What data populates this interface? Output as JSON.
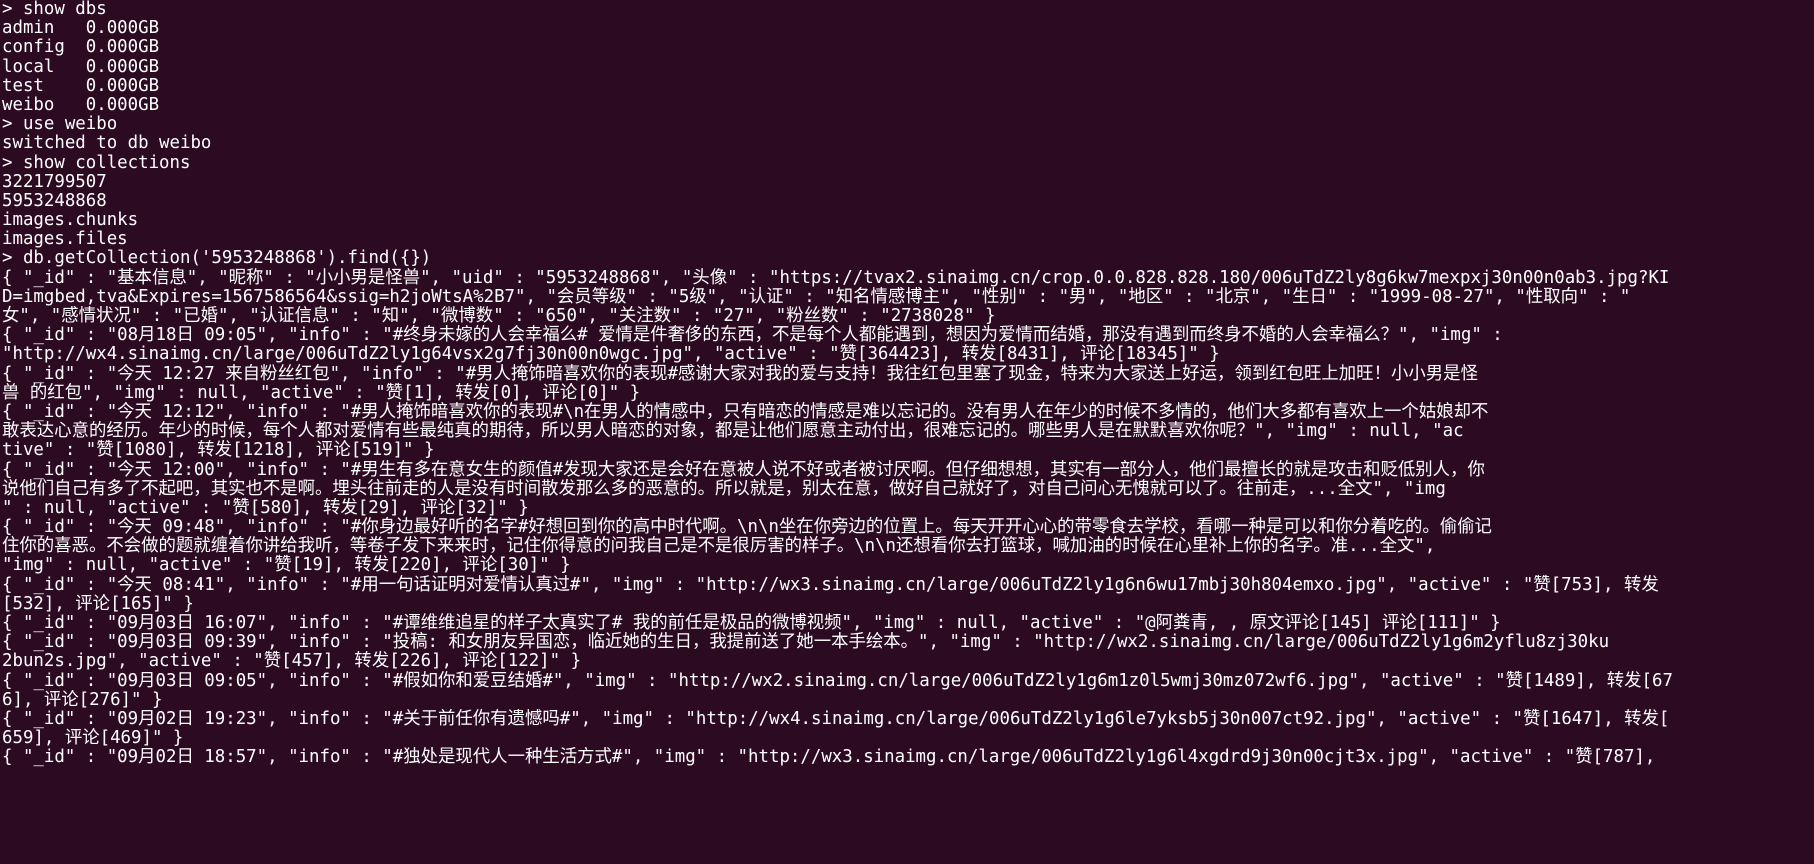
{
  "terminal": {
    "theme": {
      "background": "#2c0a22",
      "foreground": "#ffffff"
    },
    "lines": [
      "> show dbs",
      "admin   0.000GB",
      "config  0.000GB",
      "local   0.000GB",
      "test    0.000GB",
      "weibo   0.000GB",
      "> use weibo",
      "switched to db weibo",
      "> show collections",
      "3221799507",
      "5953248868",
      "images.chunks",
      "images.files",
      "> db.getCollection('5953248868').find({})",
      "{ \"_id\" : \"基本信息\", \"昵称\" : \"小小男是怪兽\", \"uid\" : \"5953248868\", \"头像\" : \"https://tvax2.sinaimg.cn/crop.0.0.828.828.180/006uTdZ2ly8g6kw7mexpxj30n00n0ab3.jpg?KI",
      "D=imgbed,tva&Expires=1567586564&ssig=h2joWtsA%2B7\", \"会员等级\" : \"5级\", \"认证\" : \"知名情感博主\", \"性别\" : \"男\", \"地区\" : \"北京\", \"生日\" : \"1999-08-27\", \"性取向\" : \"",
      "女\", \"感情状况\" : \"已婚\", \"认证信息\" : \"知\", \"微博数\" : \"650\", \"关注数\" : \"27\", \"粉丝数\" : \"2738028\" }",
      "{ \"_id\" : \"08月18日 09:05\", \"info\" : \"#终身未嫁的人会幸福么# 爱情是件奢侈的东西，不是每个人都能遇到，想因为爱情而结婚，那没有遇到而终身不婚的人会幸福么？\", \"img\" :",
      "\"http://wx4.sinaimg.cn/large/006uTdZ2ly1g64vsx2g7fj30n00n0wgc.jpg\", \"active\" : \"赞[364423], 转发[8431], 评论[18345]\" }",
      "{ \"_id\" : \"今天 12:27 来自粉丝红包\", \"info\" : \"#男人掩饰暗喜欢你的表现#感谢大家对我的爱与支持！我往红包里塞了现金，特来为大家送上好运，领到红包旺上加旺！小小男是怪",
      "兽 的红包\", \"img\" : null, \"active\" : \"赞[1], 转发[0], 评论[0]\" }",
      "{ \"_id\" : \"今天 12:12\", \"info\" : \"#男人掩饰暗喜欢你的表现#\\n在男人的情感中，只有暗恋的情感是难以忘记的。没有男人在年少的时候不多情的，他们大多都有喜欢上一个姑娘却不",
      "敢表达心意的经历。年少的时候，每个人都对爱情有些最纯真的期待，所以男人暗恋的对象，都是让他们愿意主动付出，很难忘记的。哪些男人是在默默喜欢你呢？\", \"img\" : null, \"ac",
      "tive\" : \"赞[1080], 转发[1218], 评论[519]\" }",
      "{ \"_id\" : \"今天 12:00\", \"info\" : \"#男生有多在意女生的颜值#发现大家还是会好在意被人说不好或者被讨厌啊。但仔细想想，其实有一部分人，他们最擅长的就是攻击和贬低别人，你",
      "说他们自己有多了不起吧，其实也不是啊。埋头往前走的人是没有时间散发那么多的恶意的。所以就是，别太在意，做好自己就好了，对自己问心无愧就可以了。往前走，...全文\", \"img",
      "\" : null, \"active\" : \"赞[580], 转发[29], 评论[32]\" }",
      "{ \"_id\" : \"今天 09:48\", \"info\" : \"#你身边最好听的名字#好想回到你的高中时代啊。\\n\\n坐在你旁边的位置上。每天开开心心的带零食去学校，看哪一种是可以和你分着吃的。偷偷记",
      "住你的喜恶。不会做的题就缠着你讲给我听，等卷子发下来来时，记住你得意的问我自己是不是很厉害的样子。\\n\\n还想看你去打篮球，喊加油的时候在心里补上你的名字。准...全文\",",
      "\"img\" : null, \"active\" : \"赞[19], 转发[220], 评论[30]\" }",
      "{ \"_id\" : \"今天 08:41\", \"info\" : \"#用一句话证明对爱情认真过#\", \"img\" : \"http://wx3.sinaimg.cn/large/006uTdZ2ly1g6n6wu17mbj30h804emxo.jpg\", \"active\" : \"赞[753], 转发",
      "[532], 评论[165]\" }",
      "{ \"_id\" : \"09月03日 16:07\", \"info\" : \"#谭维维追星的样子太真实了# 我的前任是极品的微博视频\", \"img\" : null, \"active\" : \"@阿粪青, , 原文评论[145] 评论[111]\" }",
      "{ \"_id\" : \"09月03日 09:39\", \"info\" : \"投稿: 和女朋友异国恋，临近她的生日，我提前送了她一本手绘本。\", \"img\" : \"http://wx2.sinaimg.cn/large/006uTdZ2ly1g6m2yflu8zj30ku",
      "2bun2s.jpg\", \"active\" : \"赞[457], 转发[226], 评论[122]\" }",
      "{ \"_id\" : \"09月03日 09:05\", \"info\" : \"#假如你和爱豆结婚#\", \"img\" : \"http://wx2.sinaimg.cn/large/006uTdZ2ly1g6m1z0l5wmj30mz072wf6.jpg\", \"active\" : \"赞[1489], 转发[67",
      "6], 评论[276]\" }",
      "{ \"_id\" : \"09月02日 19:23\", \"info\" : \"#关于前任你有遗憾吗#\", \"img\" : \"http://wx4.sinaimg.cn/large/006uTdZ2ly1g6le7yksb5j30n007ct92.jpg\", \"active\" : \"赞[1647], 转发[",
      "659], 评论[469]\" }",
      "{ \"_id\" : \"09月02日 18:57\", \"info\" : \"#独处是现代人一种生活方式#\", \"img\" : \"http://wx3.sinaimg.cn/large/006uTdZ2ly1g6l4xgdrd9j30n00cjt3x.jpg\", \"active\" : \"赞[787],"
    ]
  }
}
